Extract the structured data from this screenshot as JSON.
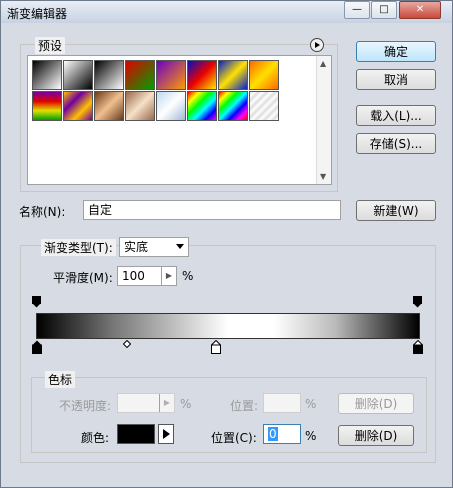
{
  "window": {
    "title": "渐变编辑器",
    "min": "—",
    "max": "□",
    "close": "✕"
  },
  "presets": {
    "label": "预设",
    "menu_icon": "play-circle-icon",
    "swatches_row1": [
      "linear-gradient(135deg,#000 0%,#fff 100%)",
      "linear-gradient(135deg,rgba(0,0,0,0),#000)",
      "linear-gradient(135deg,#000,#fff)",
      "linear-gradient(135deg,#e00000,#00a000)",
      "linear-gradient(135deg,#6a00c8,#ff9a00)",
      "linear-gradient(135deg,#0010c8,#e80000,#ffe800)",
      "linear-gradient(135deg,#0020d0,#ffe000,#0020d0)",
      "linear-gradient(135deg,#ff6a00,#ffe000,#ff6a00)"
    ],
    "swatches_row2": [
      "linear-gradient(#7a00a0,#e00000,#e0e000,#00a000)",
      "linear-gradient(135deg,#ffc000,#7000a0,#ffc000,#7000a0)",
      "linear-gradient(135deg,#6a3a1a,#f0c090,#6a3a1a)",
      "linear-gradient(135deg,#9a6a4a,#f5e0c8,#9a6a4a)",
      "linear-gradient(135deg,#c0d8f0,#fff,#a0b8d8)",
      "linear-gradient(135deg,#ff0000,#ffff00,#00ff00,#00ffff,#0000ff,#ff00ff)",
      "linear-gradient(135deg,#f00,#ff0,#0f0,#0ff,#00f,#f0f,#f00)",
      "repeating-linear-gradient(135deg,#ddd 0px,#fff 3px,#ddd 6px)"
    ]
  },
  "buttons": {
    "ok": "确定",
    "cancel": "取消",
    "load": "载入(L)...",
    "save": "存储(S)...",
    "new": "新建(W)",
    "delete_opacity": "删除(D)",
    "delete_color": "删除(D)"
  },
  "name": {
    "label": "名称(N):",
    "value": "自定"
  },
  "gradient_type": {
    "label": "渐变类型(T):",
    "value": "实底"
  },
  "smoothness": {
    "label": "平滑度(M):",
    "value": "100",
    "unit": "%"
  },
  "stops": {
    "group_label": "色标",
    "opacity_label": "不透明度:",
    "opacity_value": "",
    "opacity_unit": "%",
    "opacity_location_label": "位置:",
    "opacity_location_value": "",
    "opacity_location_unit": "%",
    "color_label": "颜色:",
    "color_value": "#000000",
    "color_location_label": "位置(C):",
    "color_location_value": "0",
    "color_location_unit": "%"
  },
  "gradient_bar": {
    "css": "linear-gradient(90deg,#000 0%,#777 20%,#fff 50%,#fff 62%,#bbb 78%,#000 100%)"
  }
}
